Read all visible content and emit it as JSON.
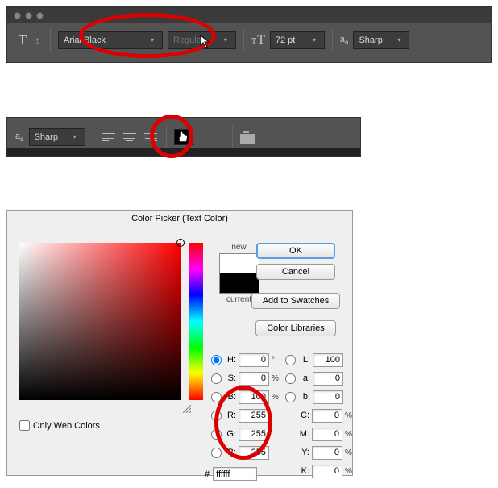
{
  "toolbar1": {
    "font_family": "Arial Black",
    "font_style": "Regular",
    "font_size": "72 pt",
    "antialias": "Sharp"
  },
  "toolbar2": {
    "antialias": "Sharp"
  },
  "picker": {
    "title": "Color Picker (Text Color)",
    "new_label": "new",
    "current_label": "current",
    "ok": "OK",
    "cancel": "Cancel",
    "add_swatch": "Add to Swatches",
    "color_libs": "Color Libraries",
    "H": "0",
    "S": "0",
    "B_hsb": "100",
    "R": "255",
    "G": "255",
    "B_rgb": "255",
    "L": "100",
    "a": "0",
    "b_lab": "0",
    "C": "0",
    "M": "0",
    "Y": "0",
    "K": "0",
    "hex": "ffffff",
    "only_web": "Only Web Colors"
  }
}
